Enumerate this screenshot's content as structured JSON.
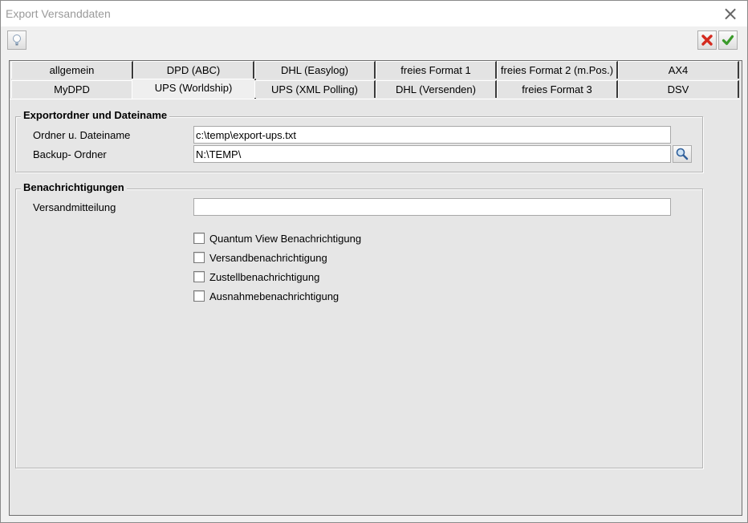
{
  "window": {
    "title": "Export Versanddaten"
  },
  "toolbar": {
    "help_icon": "lightbulb-icon",
    "cancel_icon": "red-x-icon",
    "ok_icon": "green-check-icon"
  },
  "tabs": {
    "row1": [
      "allgemein",
      "DPD (ABC)",
      "DHL (Easylog)",
      "freies Format 1",
      "freies Format 2 (m.Pos.)",
      "AX4"
    ],
    "row2": [
      "MyDPD",
      "UPS (Worldship)",
      "UPS (XML Polling)",
      "DHL (Versenden)",
      "freies Format 3",
      "DSV"
    ],
    "active": "UPS (Worldship)"
  },
  "export_group": {
    "legend": "Exportordner und Dateiname",
    "file_label": "Ordner u. Dateiname",
    "file_value": "c:\\temp\\export-ups.txt",
    "backup_label": "Backup- Ordner",
    "backup_value": "N:\\TEMP\\"
  },
  "notify_group": {
    "legend": "Benachrichtigungen",
    "message_label": "Versandmitteilung",
    "message_value": "",
    "checkboxes": [
      {
        "label": "Quantum View Benachrichtigung",
        "checked": false
      },
      {
        "label": "Versandbenachrichtigung",
        "checked": false
      },
      {
        "label": "Zustellbenachrichtigung",
        "checked": false
      },
      {
        "label": "Ausnahmebenachrichtigung",
        "checked": false
      }
    ]
  }
}
